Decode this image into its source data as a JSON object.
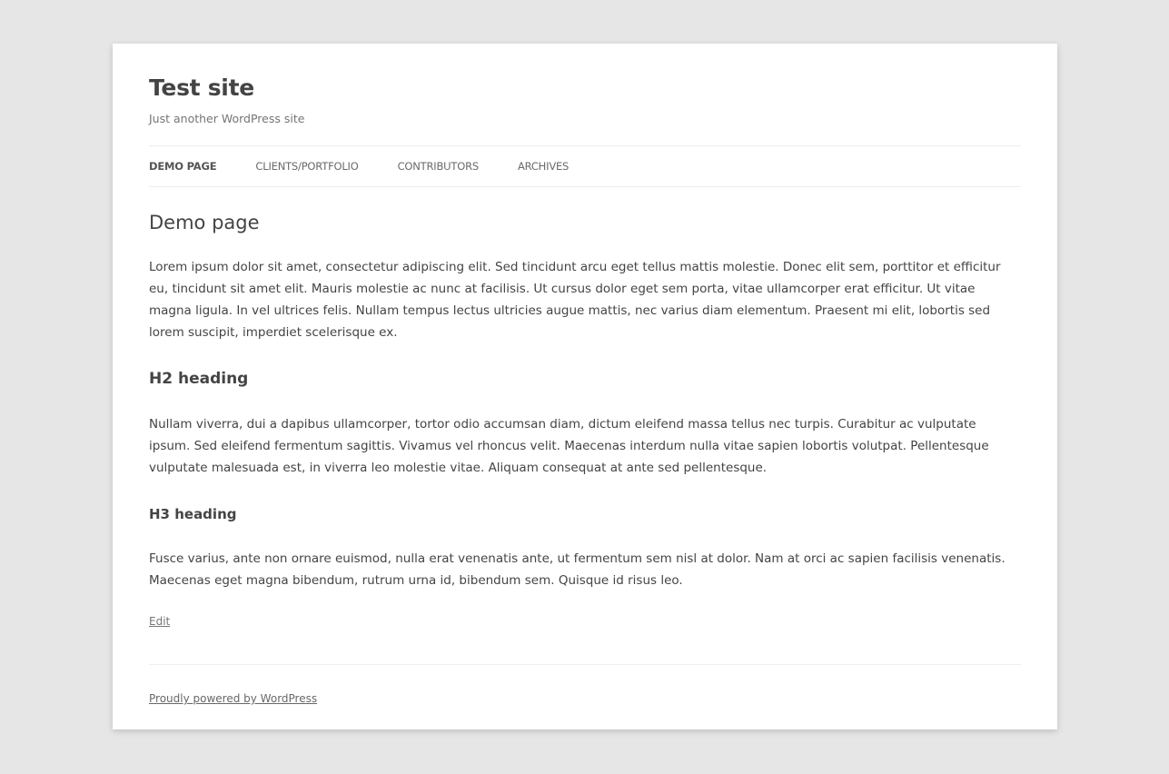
{
  "site": {
    "title": "Test site",
    "description": "Just another WordPress site"
  },
  "nav": {
    "items": [
      {
        "label": "Demo Page",
        "current": true
      },
      {
        "label": "Clients/Portfolio",
        "current": false
      },
      {
        "label": "Contributors",
        "current": false
      },
      {
        "label": "Archives",
        "current": false
      }
    ]
  },
  "article": {
    "title": "Demo page",
    "paragraph1": "Lorem ipsum dolor sit amet, consectetur adipiscing elit. Sed tincidunt arcu eget tellus mattis molestie. Donec elit sem, porttitor et efficitur eu, tincidunt sit amet elit. Mauris molestie ac nunc at facilisis. Ut cursus dolor eget sem porta, vitae ullamcorper erat efficitur. Ut vitae magna ligula. In vel ultrices felis. Nullam tempus lectus ultricies augue mattis, nec varius diam elementum. Praesent mi elit, lobortis sed lorem suscipit, imperdiet scelerisque ex.",
    "h2": "H2 heading",
    "paragraph2": "Nullam viverra, dui a dapibus ullamcorper, tortor odio accumsan diam, dictum eleifend massa tellus nec turpis. Curabitur ac vulputate ipsum. Sed eleifend fermentum sagittis. Vivamus vel rhoncus velit. Maecenas interdum nulla vitae sapien lobortis volutpat. Pellentesque vulputate malesuada est, in viverra leo molestie vitae. Aliquam consequat at ante sed pellentesque.",
    "h3": "H3 heading",
    "paragraph3": "Fusce varius, ante non ornare euismod, nulla erat venenatis ante, ut fermentum sem nisl at dolor. Nam at orci ac sapien facilisis venenatis. Maecenas eget magna bibendum, rutrum urna id, bibendum sem. Quisque id risus leo.",
    "edit_label": "Edit"
  },
  "footer": {
    "credit": "Proudly powered by WordPress"
  }
}
